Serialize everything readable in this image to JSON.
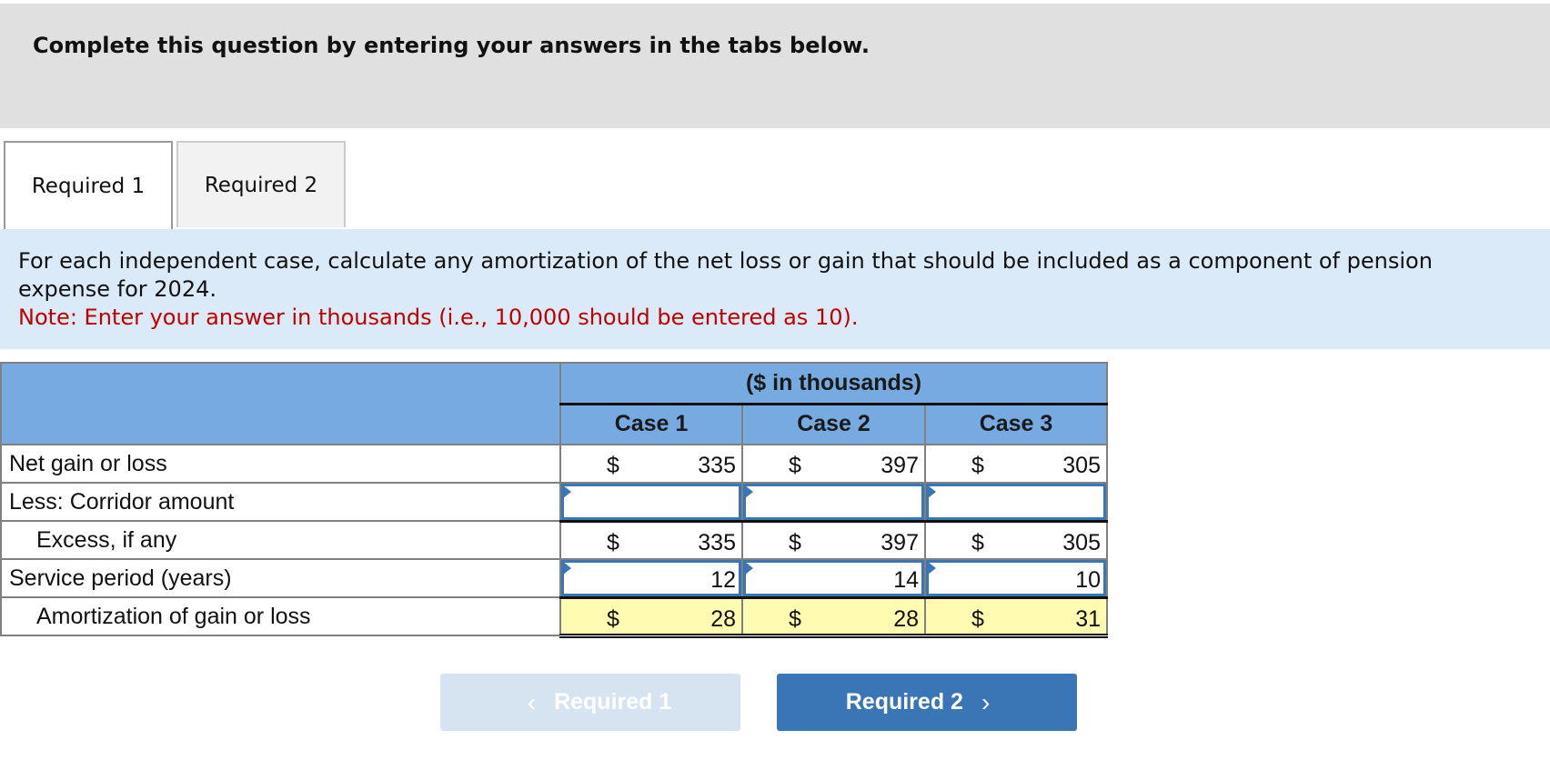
{
  "header": {
    "instruction": "Complete this question by entering your answers in the tabs below."
  },
  "tabs": [
    {
      "label": "Required 1",
      "active": true
    },
    {
      "label": "Required 2",
      "active": false
    }
  ],
  "info": {
    "text": "For each independent case, calculate any amortization of the net loss or gain that should be included as a component of pension expense for 2024.",
    "note": "Note: Enter your answer in thousands (i.e., 10,000 should be entered as 10)."
  },
  "table": {
    "units": "($ in thousands)",
    "columns": [
      "Case 1",
      "Case 2",
      "Case 3"
    ],
    "currency": "$",
    "rows": [
      {
        "label": "Net gain or loss",
        "values": [
          "335",
          "397",
          "305"
        ]
      },
      {
        "label": "Less: Corridor amount",
        "values": [
          "",
          "",
          ""
        ]
      },
      {
        "label": "Excess, if any",
        "values": [
          "335",
          "397",
          "305"
        ]
      },
      {
        "label": "Service period (years)",
        "values": [
          "12",
          "14",
          "10"
        ]
      },
      {
        "label": "Amortization of gain or loss",
        "values": [
          "28",
          "28",
          "31"
        ]
      }
    ]
  },
  "nav": {
    "prev_label": "Required 1",
    "next_label": "Required 2",
    "prev_icon": "‹",
    "next_icon": "›"
  },
  "colors": {
    "header_blue": "#77aae0",
    "accent": "#3a75b5",
    "note_red": "#c00000",
    "highlight": "#fffbb0"
  }
}
